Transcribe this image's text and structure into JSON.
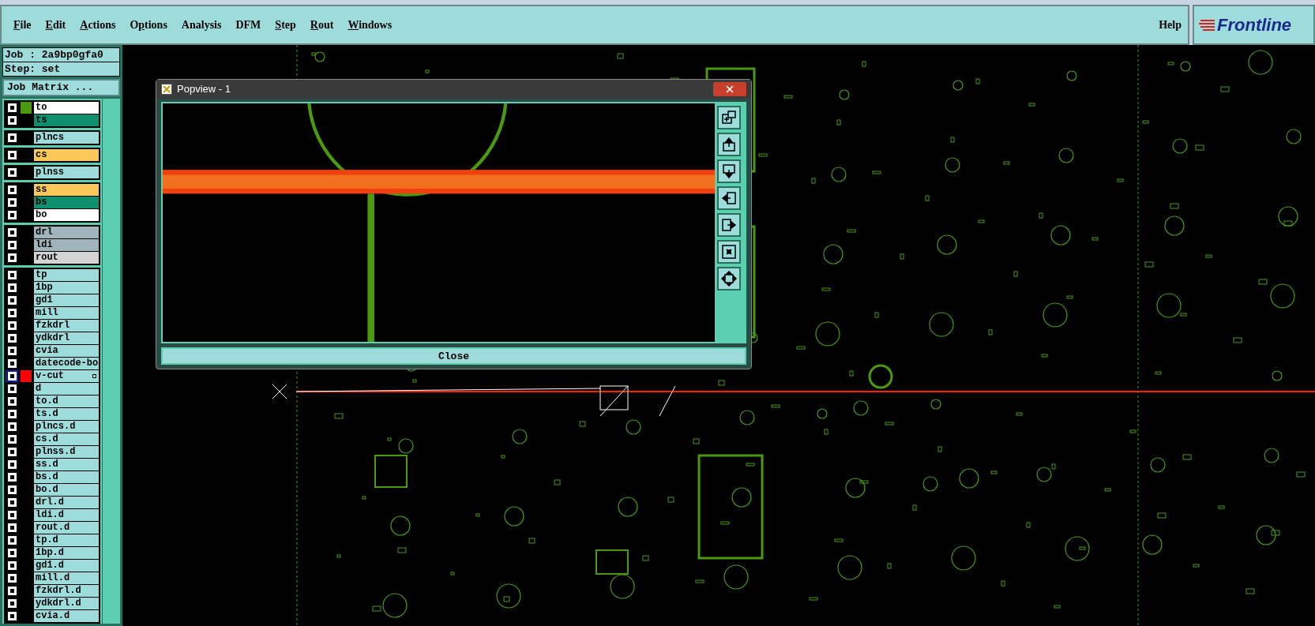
{
  "menu": [
    {
      "key": "F",
      "after": "ile"
    },
    {
      "key": "E",
      "after": "dit"
    },
    {
      "key": "A",
      "after": "ctions"
    },
    {
      "before": "O",
      "key": "p",
      "after": "tions"
    },
    {
      "before": "Analysis"
    },
    {
      "before": "DFM"
    },
    {
      "key": "S",
      "after": "tep"
    },
    {
      "key": "R",
      "after": "out"
    },
    {
      "key": "W",
      "after": "indows"
    }
  ],
  "help": "Help",
  "logo": "Frontline",
  "job": "Job : 2a9bp0gfa0",
  "step": "Step: set",
  "job_matrix_button": "Job Matrix ...",
  "layer_groups": [
    [
      {
        "name": "to",
        "color": "#ffffff",
        "swatch": {
          "color": "#4a9a10"
        },
        "selected": false,
        "expandable": false
      },
      {
        "name": "ts",
        "color": "#0f8f6e",
        "selected": false,
        "expandable": false
      }
    ],
    [
      {
        "name": "plncs",
        "color": "#9edcdc",
        "selected": false,
        "expandable": false
      }
    ],
    [
      {
        "name": "cs",
        "color": "#fcc85a",
        "selected": false,
        "expandable": false
      }
    ],
    [
      {
        "name": "plnss",
        "color": "#9edcdc",
        "selected": false,
        "expandable": false
      }
    ],
    [
      {
        "name": "ss",
        "color": "#fcc85a",
        "selected": false,
        "expandable": false
      },
      {
        "name": "bs",
        "color": "#0f8f6e",
        "selected": false,
        "expandable": false
      },
      {
        "name": "bo",
        "color": "#ffffff",
        "selected": false,
        "expandable": false
      }
    ],
    [
      {
        "name": "drl",
        "color": "#a0b4bc",
        "selected": false,
        "expandable": false
      },
      {
        "name": "ldi",
        "color": "#a0b4bc",
        "selected": false,
        "expandable": false
      },
      {
        "name": "rout",
        "color": "#d4d4d4",
        "selected": false,
        "expandable": false
      }
    ],
    [
      {
        "name": "tp",
        "color": "#9edcdc",
        "selected": false,
        "expandable": false
      },
      {
        "name": "1bp",
        "color": "#9edcdc",
        "selected": false,
        "expandable": false
      },
      {
        "name": "gd1",
        "color": "#9edcdc",
        "selected": false,
        "expandable": false
      },
      {
        "name": "mill",
        "color": "#9edcdc",
        "selected": false,
        "expandable": false
      },
      {
        "name": "fzkdrl",
        "color": "#9edcdc",
        "selected": false,
        "expandable": false
      },
      {
        "name": "ydkdrl",
        "color": "#9edcdc",
        "selected": false,
        "expandable": false
      },
      {
        "name": "cvia",
        "color": "#9edcdc",
        "selected": false,
        "expandable": false
      },
      {
        "name": "datecode-bo",
        "color": "#9edcdc",
        "selected": false,
        "expandable": false
      },
      {
        "name": "v-cut",
        "color": "#9edcdc",
        "swatch": {
          "color": "#ff0000"
        },
        "selected": true,
        "expandable": true
      },
      {
        "name": "d",
        "color": "#9edcdc",
        "selected": false,
        "expandable": false
      },
      {
        "name": "to.d",
        "color": "#9edcdc",
        "selected": false,
        "expandable": false
      },
      {
        "name": "ts.d",
        "color": "#9edcdc",
        "selected": false,
        "expandable": false
      },
      {
        "name": "plncs.d",
        "color": "#9edcdc",
        "selected": false,
        "expandable": false
      },
      {
        "name": "cs.d",
        "color": "#9edcdc",
        "selected": false,
        "expandable": false
      },
      {
        "name": "plnss.d",
        "color": "#9edcdc",
        "selected": false,
        "expandable": false
      },
      {
        "name": "ss.d",
        "color": "#9edcdc",
        "selected": false,
        "expandable": false
      },
      {
        "name": "bs.d",
        "color": "#9edcdc",
        "selected": false,
        "expandable": false
      },
      {
        "name": "bo.d",
        "color": "#9edcdc",
        "selected": false,
        "expandable": false
      },
      {
        "name": "drl.d",
        "color": "#9edcdc",
        "selected": false,
        "expandable": false
      },
      {
        "name": "ldi.d",
        "color": "#9edcdc",
        "selected": false,
        "expandable": false
      },
      {
        "name": "rout.d",
        "color": "#9edcdc",
        "selected": false,
        "expandable": false
      },
      {
        "name": "tp.d",
        "color": "#9edcdc",
        "selected": false,
        "expandable": false
      },
      {
        "name": "1bp.d",
        "color": "#9edcdc",
        "selected": false,
        "expandable": false
      },
      {
        "name": "gd1.d",
        "color": "#9edcdc",
        "selected": false,
        "expandable": false
      },
      {
        "name": "mill.d",
        "color": "#9edcdc",
        "selected": false,
        "expandable": false
      },
      {
        "name": "fzkdrl.d",
        "color": "#9edcdc",
        "selected": false,
        "expandable": false
      },
      {
        "name": "ydkdrl.d",
        "color": "#9edcdc",
        "selected": false,
        "expandable": false
      },
      {
        "name": "cvia.d",
        "color": "#9edcdc",
        "selected": false,
        "expandable": false
      }
    ]
  ],
  "popview": {
    "title": "Popview - 1",
    "close_button": "Close"
  }
}
